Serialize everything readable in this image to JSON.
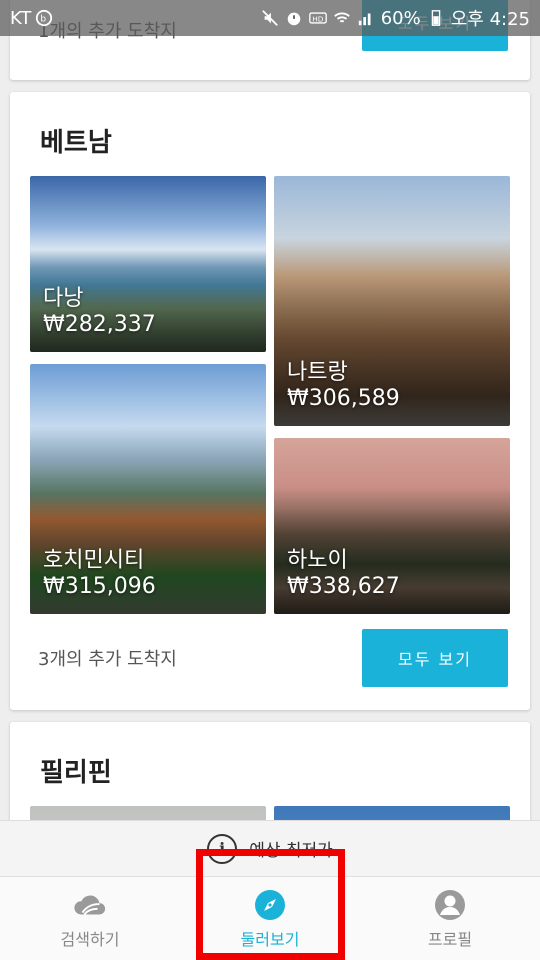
{
  "status_bar": {
    "carrier": "KT",
    "battery": "60%",
    "time": "오후 4:25"
  },
  "top_card": {
    "more_text": "1개의 추가 도착지",
    "more_button": "모두 보기"
  },
  "vietnam": {
    "title": "베트남",
    "destinations": [
      {
        "city": "다낭",
        "price": "₩282,337"
      },
      {
        "city": "나트랑",
        "price": "₩306,589"
      },
      {
        "city": "호치민시티",
        "price": "₩315,096"
      },
      {
        "city": "하노이",
        "price": "₩338,627"
      }
    ],
    "more_text": "3개의 추가 도착지",
    "more_button": "모두 보기"
  },
  "philippines": {
    "title": "필리핀"
  },
  "estimate_bar": {
    "label": "예상 최저가"
  },
  "bottom_nav": {
    "items": [
      {
        "label": "검색하기",
        "icon": "cloud-search-icon"
      },
      {
        "label": "둘러보기",
        "icon": "compass-icon"
      },
      {
        "label": "프로필",
        "icon": "profile-icon"
      }
    ],
    "active_index": 1
  },
  "colors": {
    "accent": "#1ab2d8",
    "highlight": "#f10000"
  }
}
